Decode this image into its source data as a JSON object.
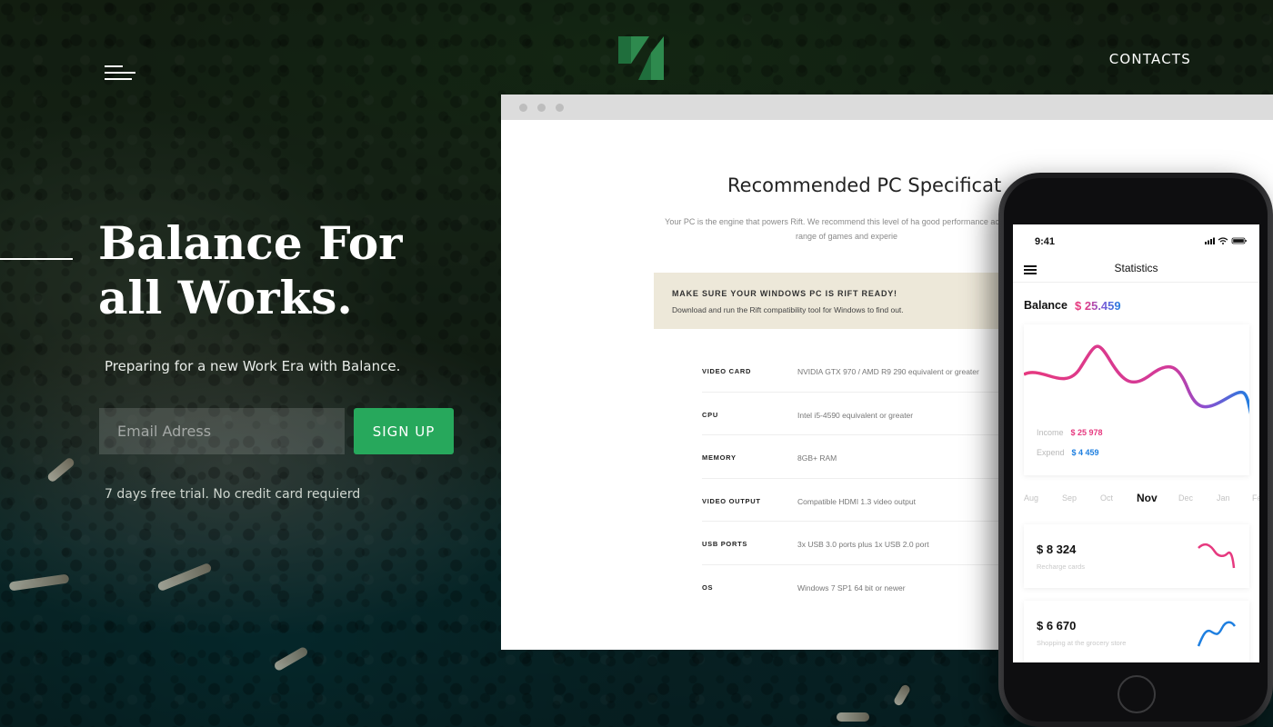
{
  "header": {
    "contacts_label": "CONTACTS"
  },
  "hero": {
    "title": "Balance For all Works.",
    "subtitle": "Preparing for a new Work Era with Balance.",
    "email_placeholder": "Email Adress",
    "signup_label": "SIGN UP",
    "trial_text": "7 days free trial. No credit card requierd"
  },
  "browser": {
    "title": "Recommended PC Specificat",
    "description": "Your PC is the engine that powers Rift. We recommend this level of ha good performance across the range of games and experie",
    "alert": {
      "title": "MAKE SURE YOUR WINDOWS PC IS RIFT READY!",
      "text": "Download and run the Rift compatibility tool for Windows to find out."
    },
    "specs": [
      {
        "label": "VIDEO CARD",
        "value": "NVIDIA GTX 970 / AMD R9 290 equivalent or greater"
      },
      {
        "label": "CPU",
        "value": "Intel i5-4590 equivalent or greater"
      },
      {
        "label": "MEMORY",
        "value": "8GB+ RAM"
      },
      {
        "label": "VIDEO OUTPUT",
        "value": "Compatible HDMI 1.3 video output"
      },
      {
        "label": "USB PORTS",
        "value": "3x USB 3.0 ports plus 1x USB 2.0 port"
      },
      {
        "label": "OS",
        "value": "Windows 7 SP1 64 bit or newer"
      }
    ]
  },
  "phone": {
    "time": "9:41",
    "title": "Statistics",
    "balance_label": "Balance",
    "balance_currency": "$",
    "balance_value": "25.459",
    "income_label": "Income",
    "income_value": "$ 25 978",
    "expend_label": "Expend",
    "expend_value": "$ 4 459",
    "months": [
      {
        "label": "Aug",
        "active": false
      },
      {
        "label": "Sep",
        "active": false
      },
      {
        "label": "Oct",
        "active": false
      },
      {
        "label": "Nov",
        "active": true
      },
      {
        "label": "Dec",
        "active": false
      },
      {
        "label": "Jan",
        "active": false
      },
      {
        "label": "Fe",
        "active": false
      }
    ],
    "cards": [
      {
        "amount": "$ 8 324",
        "subtitle": "Recharge cards"
      },
      {
        "amount": "$ 6 670",
        "subtitle": "Shopping at the grocery store"
      }
    ]
  },
  "colors": {
    "accent_green": "#27a85c",
    "logo_green": "#2e8a4e",
    "pink": "#e6397f",
    "blue": "#1e7fe0",
    "alert_bg": "#ede8d9"
  }
}
